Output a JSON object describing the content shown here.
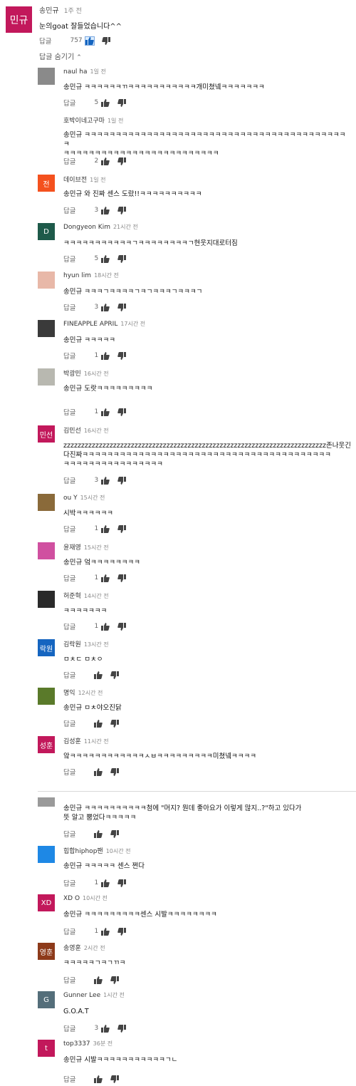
{
  "top_comment": {
    "avatar_text": "민규",
    "avatar_color": "#c2185b",
    "author": "송민규",
    "time": "1주 전",
    "text": "눈의goat 잘들었습니다^^",
    "reply_label": "답글",
    "likes": "757",
    "toggle_label": "답글 숨기기"
  },
  "reply_label": "답글",
  "replies": [
    {
      "author": "naul ha",
      "time": "1일 전",
      "avatar_text": "",
      "avatar_color": "#8a8a8a",
      "text": "송민규 ㅋㅋㅋㅋㅋㅋㄲㅋㅋㅋㅋㅋㅋㅋㅋㅋㅋㅋ개미쳤넼ㅋㅋㅋㅋㅋㅋㅋ",
      "likes": "5"
    },
    {
      "author": "호박이네고구마",
      "time": "1일 전",
      "avatar_text": "",
      "avatar_color": "#ffffff",
      "text": "송민규 ㅋㅋㅋㅋㅋㅋㅋㅋㅋㅋㅋㅋㅋㅋㅋㅋㅋㅋㅋㅋㅋㅋㅋㅋㅋㅋㅋㅋㅋㅋㅋㅋㅋㅋㅋㅋㅋㅋㅋㅋㅋㅋㅋ\nㅋㅋㅋㅋㅋㅋㅋㅋㅋㅋㅋㅋㅋㅋㅋㅋㅋㅋㅋㅋㅋㅋㅋㅋㅋ",
      "likes": "2"
    },
    {
      "author": "데이브전",
      "time": "1일 전",
      "avatar_text": "전",
      "avatar_color": "#f4511e",
      "text": "송민규 와 진짜 센스 도랐!!ㅋㅋㅋㅋㅋㅋㅋㅋㅋㅋ",
      "likes": "3"
    },
    {
      "author": "Dongyeon Kim",
      "time": "21시간 전",
      "avatar_text": "D",
      "avatar_color": "#1e5a4a",
      "text": "ㅋㅋㅋㅋㅋㅋㅋㅋㅋㅋㅋㄱㅋㅋㅋㅋㅋㅋㅋㅋㄱ현웃지대로터짐",
      "likes": "5"
    },
    {
      "author": "hyun lim",
      "time": "18시간 전",
      "avatar_text": "",
      "avatar_color": "#e8b8a8",
      "text": "송민규 ㅋㅋㅋㄱㅋㅋㅋㅋㄱㅋㄱㅋㅋㅋㄱㅋㅋㅋㄱ",
      "likes": "3"
    },
    {
      "author": "FINEAPPLE APRIL",
      "time": "17시간 전",
      "avatar_text": "",
      "avatar_color": "#3a3a3a",
      "text": "송민규 ㅋㅋㅋㅋㅋ",
      "likes": "1"
    },
    {
      "author": "박광민",
      "time": "16시간 전",
      "avatar_text": "",
      "avatar_color": "#b8b8b0",
      "text": "송민규 도랏ㅋㅋㅋㅋㅋㅋㅋㅋㅋ",
      "likes": "1"
    },
    {
      "author": "김민선",
      "time": "16시간 전",
      "avatar_text": "민선",
      "avatar_color": "#c2185b",
      "text": "zzzzzzzzzzzzzzzzzzzzzzzzzzzzzzzzzzzzzzzzzzzzzzzzzzzzzzzzzzzzzzzzzzzzzzzzzz존나웃긴다진짜ㅋㅋㅋㅋㅋㅋㅋㅋㅋㅋㅋㅋㅋㅋㅋㅋㅋㅋㅋㅋㅋㅋㅋㅋㅋㅋㅋㅋㅋㅋㅋㅋㅋㅋㅋㅋㅋㅋㅋㅋ\nㅋㅋㅋㅋㅋㅋㅋㅋㅋㅋㅋㅋㅋㅋㅋㅋ",
      "likes": "3"
    },
    {
      "author": "ou Y",
      "time": "15시간 전",
      "avatar_text": "",
      "avatar_color": "#8a6a3a",
      "text": "시박ㅋㅋㅋㅋㅋㅋ",
      "likes": "1"
    },
    {
      "author": "윤재영",
      "time": "15시간 전",
      "avatar_text": "",
      "avatar_color": "#d050a0",
      "text": "송민규 엌ㅋㅋㅋㅋㅋㅋㅋㅋ",
      "likes": "1"
    },
    {
      "author": "허준혁",
      "time": "14시간 전",
      "avatar_text": "",
      "avatar_color": "#2a2a2a",
      "text": "ㅋㅋㅋㅋㅋㅋㅋ",
      "likes": "1"
    },
    {
      "author": "김락원",
      "time": "13시간 전",
      "avatar_text": "락원",
      "avatar_color": "#1565c0",
      "text": "ㅁㅊㄷ ㅁㅊㅇ",
      "likes": ""
    },
    {
      "author": "명익",
      "time": "12시간 전",
      "avatar_text": "",
      "avatar_color": "#5a7a2a",
      "text": "송민규 ㅁㅊ야오진닭",
      "likes": ""
    },
    {
      "author": "김성훈",
      "time": "11시간 전",
      "avatar_text": "성훈",
      "avatar_color": "#c2185b",
      "text": "앜ㅋㅋㅋㅋㅋㅋㅋㅋㅋㅋㅋㅋㅅㅂㅋㅋㅋㅋㅋㅋㅋㅋㅋ미쳤넼ㅋㅋㅋㅋ",
      "likes": ""
    },
    {
      "author": "",
      "time": "",
      "avatar_text": "",
      "avatar_color": "#9a9a9a",
      "text": "송민규 ㅋㅋㅋㅋㅋㅋㅋㅋㅋㅋ첨에 \"머지? 뭔데 좋아요가 이렇게 많지..?\"하고 있다가\n뜻 알고 뿜었다ㅋㅋㅋㅋㅋ",
      "likes": ""
    },
    {
      "author": "힙합hiphop팬",
      "time": "10시간 전",
      "avatar_text": "",
      "avatar_color": "#1e88e5",
      "text": "송민규 ㅋㅋㅋㅋㅋ 센스 쩐다",
      "likes": "1"
    },
    {
      "author": "XD O",
      "time": "10시간 전",
      "avatar_text": "XD",
      "avatar_color": "#c2185b",
      "text": "송민규 ㅋㅋㅋㅋㅋㅋㅋㅋㅋ센스 시발ㅋㅋㅋㅋㅋㅋㅋㅋ",
      "likes": "1"
    },
    {
      "author": "송영훈",
      "time": "2시간 전",
      "avatar_text": "영훈",
      "avatar_color": "#8d3a1a",
      "text": "ㅋㅋㅋㅋㅋㄱㅋㄱㄲㅋ",
      "likes": ""
    },
    {
      "author": "Gunner Lee",
      "time": "1시간 전",
      "avatar_text": "G",
      "avatar_color": "#546e7a",
      "text": "G.O.A.T",
      "likes": "3"
    },
    {
      "author": "top3337",
      "time": "36분 전",
      "avatar_text": "t",
      "avatar_color": "#c2185b",
      "text": "송민규 시발ㅋㅋㅋㅋㅋㅋㅋㅋㅋㅋㅋㄱㄴ",
      "likes": ""
    }
  ]
}
